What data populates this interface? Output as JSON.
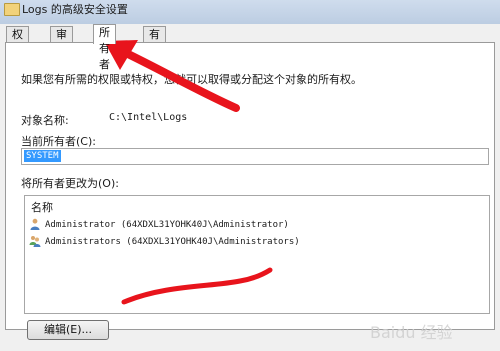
{
  "window": {
    "title": "Logs 的高级安全设置"
  },
  "tabs": [
    {
      "label": "权限"
    },
    {
      "label": "审核"
    },
    {
      "label": "所有者"
    },
    {
      "label": "有效权限"
    }
  ],
  "owner_page": {
    "description": "如果您有所需的权限或特权，您就可以取得或分配这个对象的所有权。",
    "object_name_label": "对象名称:",
    "object_name_value": "C:\\Intel\\Logs",
    "current_owner_label": "当前所有者(C):",
    "current_owner_value": "SYSTEM",
    "change_owner_label": "将所有者更改为(O):",
    "list_header": "名称",
    "owners": [
      {
        "name": "Administrator (64XDXL31YOHK40J\\Administrator)",
        "icon": "single-user-icon"
      },
      {
        "name": "Administrators (64XDXL31YOHK40J\\Administrators)",
        "icon": "group-users-icon"
      }
    ],
    "edit_button": "编辑(E)..."
  },
  "colors": {
    "selection": "#3399ff",
    "annotation": "#e8141c"
  },
  "watermark": {
    "text": "Baidu 经验"
  }
}
